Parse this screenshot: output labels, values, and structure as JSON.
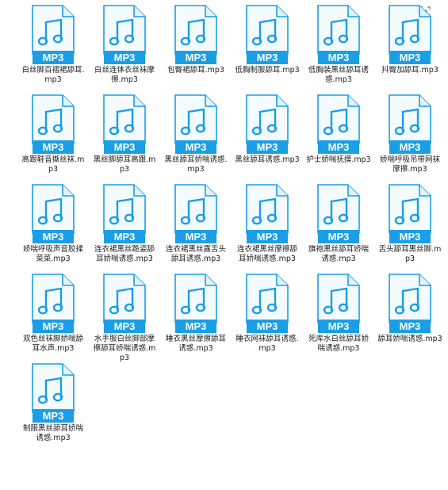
{
  "view": {
    "corner_icon": "view-toggle-icon",
    "icon_label": "MP3",
    "colors": {
      "accent": "#1a9ee6",
      "accent_dark": "#0f86cc",
      "page_fill": "#f4fbff",
      "text": "#1a1a1a"
    }
  },
  "files": [
    {
      "name": "白丝脚百褶裙舔耳.mp3"
    },
    {
      "name": "白丝连体衣丝袜摩擦.mp3"
    },
    {
      "name": "包臀裙舔耳.mp3"
    },
    {
      "name": "低胸制服舔耳.mp3"
    },
    {
      "name": "低胸装黑丝舔耳诱惑.mp3"
    },
    {
      "name": "抖臀加舔耳.mp3"
    },
    {
      "name": "高跟鞋音撕丝袜.mp3"
    },
    {
      "name": "黑丝脚舔耳高跟.mp3"
    },
    {
      "name": "黑丝舔耳娇喘诱惑.mp3"
    },
    {
      "name": "黑丝舔耳诱惑.mp3"
    },
    {
      "name": "护士娇喘抚摸.mp3"
    },
    {
      "name": "娇喘呼吸吊带网袜摩擦.mp3"
    },
    {
      "name": "娇喘呼吸声音胶揉菜菜.mp3"
    },
    {
      "name": "连衣裙黑丝跪姿舔耳娇喘诱惑.mp3"
    },
    {
      "name": "连衣裙黑丝露舌头舔耳诱惑.mp3"
    },
    {
      "name": "连衣裙黑丝摩擦舔耳娇喘诱惑.mp3"
    },
    {
      "name": "旗袍黑丝舔耳娇喘诱惑.mp3"
    },
    {
      "name": "舌头舔耳黑丝脚.mp3"
    },
    {
      "name": "双色丝袜脚娇喘舔耳水声.mp3"
    },
    {
      "name": "水手服白丝脚部摩擦舔耳娇喘诱惑.mp3"
    },
    {
      "name": "睡衣黑丝摩擦舔耳诱惑.mp3"
    },
    {
      "name": "睡衣网袜舔耳诱惑.mp3"
    },
    {
      "name": "死库水白丝舔耳娇喘诱惑.mp3"
    },
    {
      "name": "舔耳娇喘诱惑.mp3"
    },
    {
      "name": "制服黑丝舔耳娇喘诱惑.mp3"
    }
  ]
}
